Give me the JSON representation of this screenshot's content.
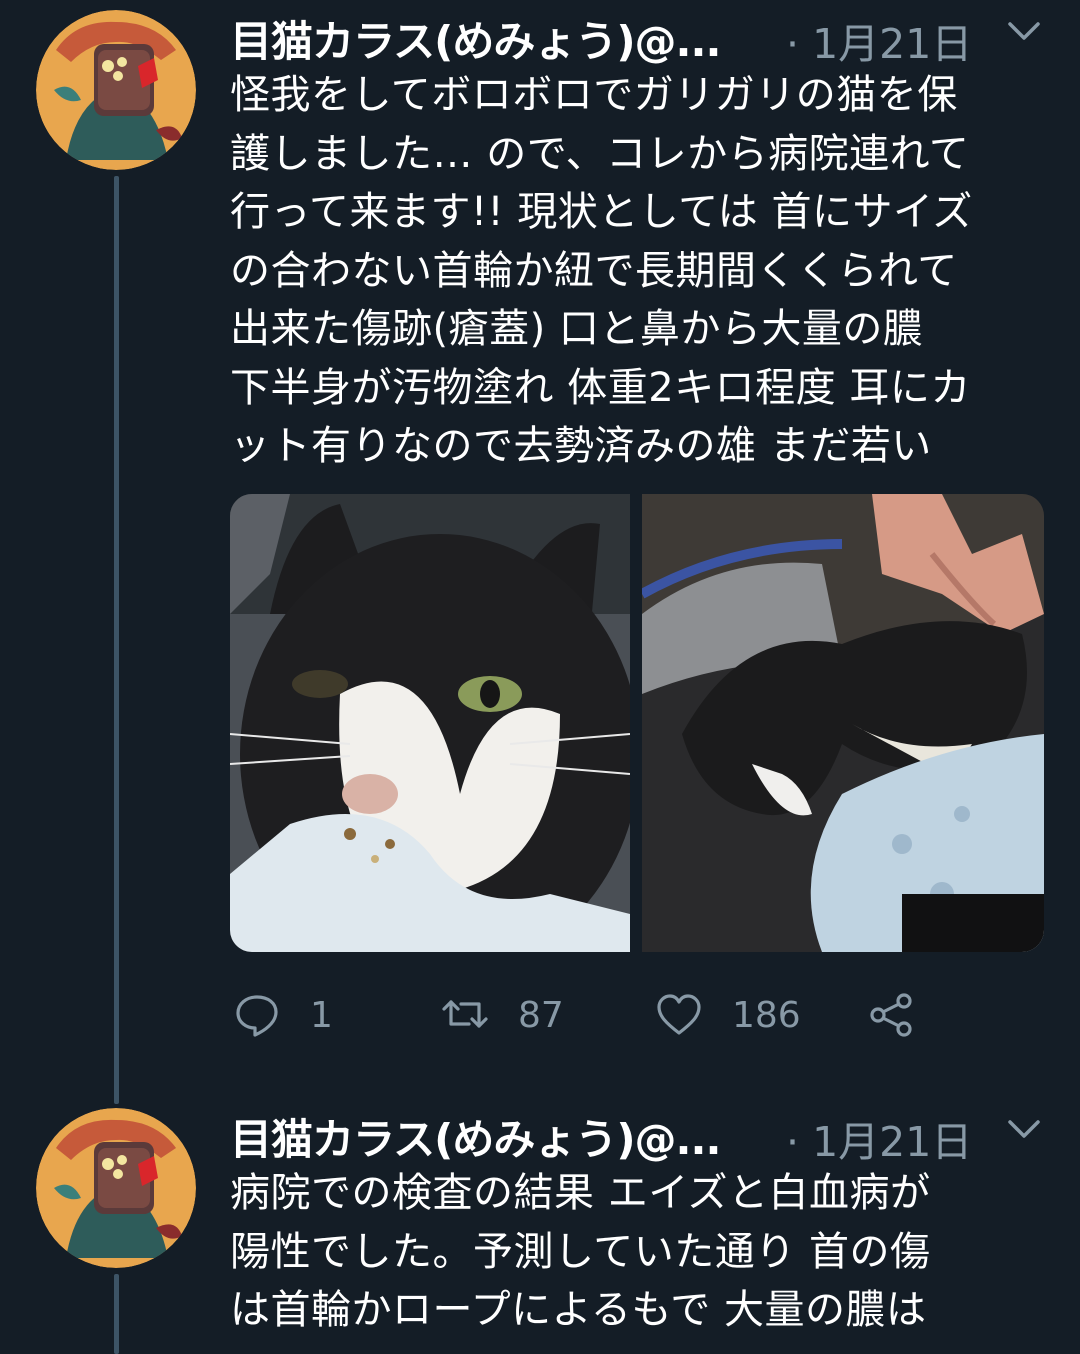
{
  "tweets": [
    {
      "author": "目猫カラス(めみょう)@...",
      "date": "· 1月21日",
      "text": "怪我をしてボロボロでガリガリの猫を保\n護しました… ので、コレから病院連れて\n行って来ます!! 現状としては 首にサイズ\nの合わない首輪か紐で長期間くくられて\n出来た傷跡(瘡蓋) 口と鼻から大量の膿\n下半身が汚物塗れ 体重2キロ程度 耳にカ\nット有りなので去勢済みの雄 まだ若い",
      "media": [
        "cat-photo-closeup",
        "cat-photo-petted"
      ],
      "actions": {
        "replies": "1",
        "retweets": "87",
        "likes": "186"
      }
    },
    {
      "author": "目猫カラス(めみょう)@...",
      "date": "· 1月21日",
      "text": "病院での検査の結果 エイズと白血病が\n陽性でした。予測していた通り 首の傷\nは首輪かロープによるもで 大量の膿は"
    }
  ],
  "icons": {
    "reply": "reply-icon",
    "retweet": "retweet-icon",
    "like": "heart-icon",
    "share": "share-icon",
    "menu": "chevron-down-icon"
  },
  "colors": {
    "background": "#141d26",
    "text": "#ffffff",
    "secondary": "#8899a6",
    "thread_line": "#3d5466"
  }
}
